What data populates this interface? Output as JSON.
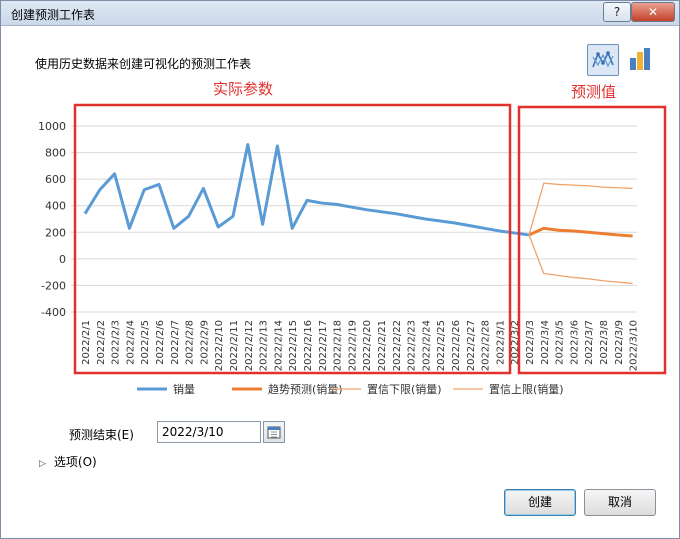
{
  "window": {
    "title": "创建预测工作表",
    "help_label": "?",
    "close_label": "✕"
  },
  "description": "使用历史数据来创建可视化的预测工作表",
  "view_buttons": {
    "line_icon": "line-chart-icon",
    "column_icon": "column-chart-icon"
  },
  "annotations": {
    "actual": "实际参数",
    "forecast": "预测值",
    "box_color": "#e0312f"
  },
  "chart_data": {
    "type": "line",
    "x": [
      "2022/2/1",
      "2022/2/2",
      "2022/2/3",
      "2022/2/4",
      "2022/2/5",
      "2022/2/6",
      "2022/2/7",
      "2022/2/8",
      "2022/2/9",
      "2022/2/10",
      "2022/2/11",
      "2022/2/12",
      "2022/2/13",
      "2022/2/14",
      "2022/2/15",
      "2022/2/16",
      "2022/2/17",
      "2022/2/18",
      "2022/2/19",
      "2022/2/20",
      "2022/2/21",
      "2022/2/22",
      "2022/2/23",
      "2022/2/24",
      "2022/2/25",
      "2022/2/26",
      "2022/2/27",
      "2022/2/28",
      "2022/3/1",
      "2022/3/2",
      "2022/3/3",
      "2022/3/4",
      "2022/3/5",
      "2022/3/6",
      "2022/3/7",
      "2022/3/8",
      "2022/3/9",
      "2022/3/10"
    ],
    "yticks": [
      1000,
      800,
      600,
      400,
      200,
      0,
      -200,
      -400
    ],
    "ylim": [
      -400,
      1000
    ],
    "grid": true,
    "legend_position": "bottom",
    "series": [
      {
        "name": "销量",
        "color": "#5b9bd5",
        "width": 3,
        "values": [
          340,
          520,
          640,
          230,
          520,
          560,
          230,
          320,
          530,
          240,
          320,
          860,
          260,
          850,
          230,
          440,
          420,
          410,
          390,
          370,
          355,
          340,
          320,
          300,
          285,
          270,
          250,
          230,
          210,
          195,
          180,
          null,
          null,
          null,
          null,
          null,
          null,
          null
        ]
      },
      {
        "name": "趋势预测(销量)",
        "color": "#ed7d31",
        "width": 3,
        "values": [
          null,
          null,
          null,
          null,
          null,
          null,
          null,
          null,
          null,
          null,
          null,
          null,
          null,
          null,
          null,
          null,
          null,
          null,
          null,
          null,
          null,
          null,
          null,
          null,
          null,
          null,
          null,
          null,
          null,
          null,
          180,
          230,
          215,
          210,
          200,
          190,
          180,
          172
        ]
      },
      {
        "name": "置信下限(销量)",
        "color": "#f0a36b",
        "width": 1.3,
        "values": [
          null,
          null,
          null,
          null,
          null,
          null,
          null,
          null,
          null,
          null,
          null,
          null,
          null,
          null,
          null,
          null,
          null,
          null,
          null,
          null,
          null,
          null,
          null,
          null,
          null,
          null,
          null,
          null,
          null,
          null,
          180,
          -110,
          -125,
          -140,
          -150,
          -165,
          -175,
          -185
        ]
      },
      {
        "name": "置信上限(销量)",
        "color": "#f0a36b",
        "width": 1.3,
        "values": [
          null,
          null,
          null,
          null,
          null,
          null,
          null,
          null,
          null,
          null,
          null,
          null,
          null,
          null,
          null,
          null,
          null,
          null,
          null,
          null,
          null,
          null,
          null,
          null,
          null,
          null,
          null,
          null,
          null,
          null,
          180,
          570,
          560,
          555,
          550,
          540,
          535,
          530
        ]
      }
    ]
  },
  "forecast_end": {
    "label": "预测结束(E)",
    "value": "2022/3/10",
    "calendar_icon": "calendar-icon"
  },
  "options": {
    "label": "选项(O)"
  },
  "buttons": {
    "create": "创建",
    "cancel": "取消"
  }
}
